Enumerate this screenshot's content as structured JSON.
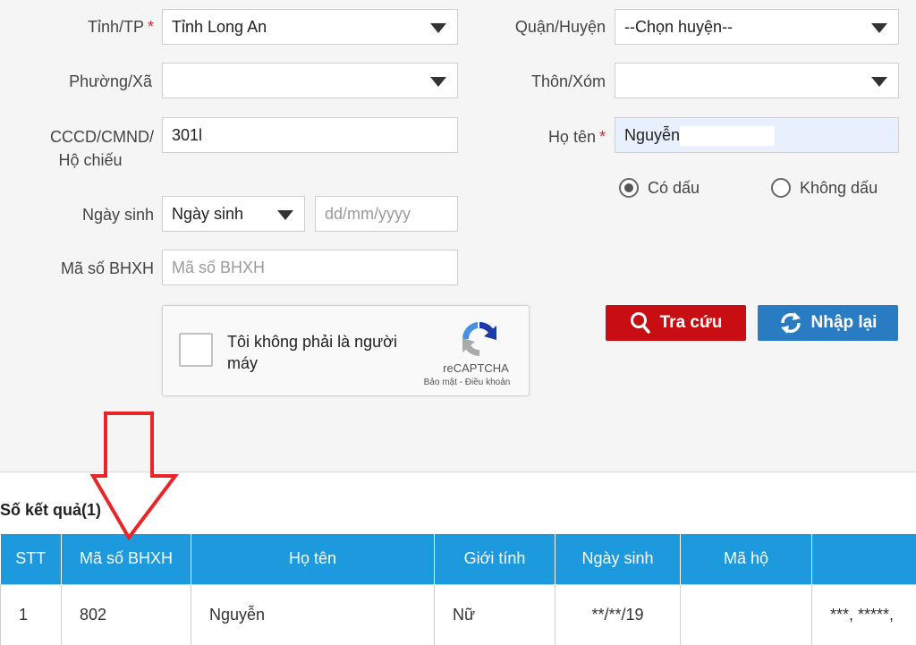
{
  "form": {
    "province_label": "Tỉnh/TP",
    "province_value": "Tỉnh Long An",
    "district_label": "Quận/Huyện",
    "district_value": "--Chọn huyện--",
    "ward_label": "Phường/Xã",
    "ward_value": "",
    "village_label": "Thôn/Xóm",
    "village_value": "",
    "id_label_line1": "CCCD/CMND/",
    "id_label_line2": "Hộ chiếu",
    "id_value": "301l",
    "name_label": "Họ tên",
    "name_value": "Nguyễn",
    "accent_option": "Có dấu",
    "no_accent_option": "Không dấu",
    "dob_label": "Ngày sinh",
    "dob_select_value": "Ngày sinh",
    "dob_placeholder": "dd/mm/yyyy",
    "bhxh_label": "Mã số BHXH",
    "bhxh_placeholder": "Mã số BHXH",
    "required_mark": "*"
  },
  "captcha": {
    "text": "Tôi không phải là người máy",
    "brand": "reCAPTCHA",
    "links": "Bảo mật - Điều khoản"
  },
  "buttons": {
    "search_label": "Tra cứu",
    "reset_label": "Nhập lại"
  },
  "results": {
    "count_label": "Số kết quả(1)",
    "columns": [
      "STT",
      "Mã số BHXH",
      "Họ tên",
      "Giới tính",
      "Ngày sinh",
      "Mã hộ",
      ""
    ],
    "rows": [
      {
        "stt": "1",
        "bhxh": "802",
        "name": "Nguyễn",
        "gender": "Nữ",
        "dob": "**/**/19",
        "household": "",
        "address": "***, *****,"
      }
    ]
  },
  "colors": {
    "search_button": "#c80e13",
    "reset_button": "#2a7cc2",
    "table_header": "#1d9add",
    "arrow": "#e8262a"
  }
}
